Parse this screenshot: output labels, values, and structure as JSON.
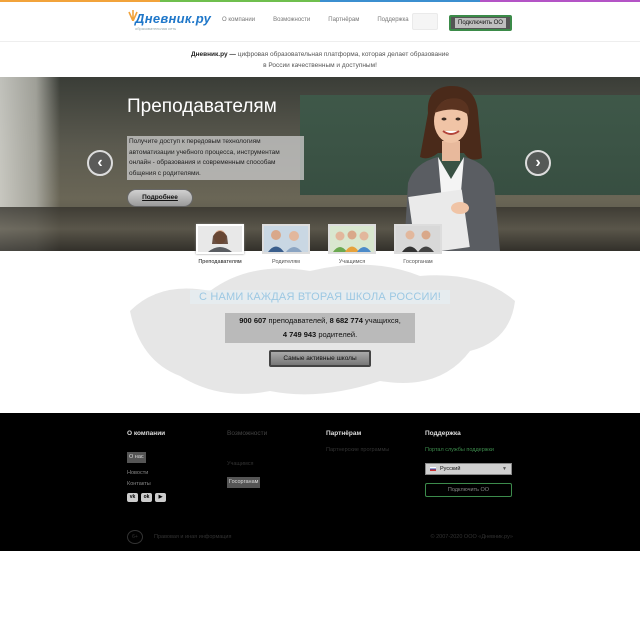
{
  "colors": {
    "top_stripe": [
      "#f2a33b",
      "#6fbf4e",
      "#3b8fd0",
      "#b454c6"
    ],
    "brand_blue": "#1f77c9",
    "accent_green": "#3c8b4c"
  },
  "header": {
    "logo_name": "Дневник.ру",
    "logo_tagline": "образовательная сеть",
    "nav": [
      "О компании",
      "Возможности",
      "Партнёрам",
      "Поддержка"
    ],
    "connect_label": "Подключить ОО"
  },
  "intro": {
    "brand": "Дневник.ру —",
    "line1": "цифровая образовательная платформа, которая делает образование",
    "line2": "в России качественным и доступным!"
  },
  "hero": {
    "title": "Преподавателям",
    "text": "Получите доступ к передовым технологиям автоматизации учебного процесса, инструментам онлайн - образования и современным способам общения с родителями.",
    "more_label": "Подробнее",
    "prev_icon": "chevron-left-icon",
    "next_icon": "chevron-right-icon"
  },
  "audiences": [
    {
      "label": "Преподавателям",
      "active": true
    },
    {
      "label": "Родителям",
      "active": false
    },
    {
      "label": "Учащимся",
      "active": false
    },
    {
      "label": "Госорганам",
      "active": false
    }
  ],
  "stats": {
    "claim": "С НАМИ КАЖДАЯ ВТОРАЯ ШКОЛА РОССИИ!",
    "teachers_count": "900 607",
    "teachers_label": "преподавателей,",
    "students_count": "8 682 774",
    "students_label": "учащихся,",
    "parents_count": "4 749 943",
    "parents_label": "родителей.",
    "button_label": "Самые активные школы"
  },
  "footer": {
    "col1": {
      "heading": "О компании",
      "items": [
        "О нас",
        "Новости",
        "Контакты"
      ],
      "social": [
        "vk-icon",
        "ok-icon",
        "youtube-icon"
      ]
    },
    "col2": {
      "heading": "Возможности",
      "items": [
        "Учащимся",
        "Госорганам"
      ]
    },
    "col3": {
      "heading": "Партнёрам",
      "items": [
        "Партнерские программы"
      ]
    },
    "col4": {
      "heading": "Поддержка",
      "items": [
        "Портал службы поддержки"
      ],
      "language": "Русский",
      "connect_label": "Подключить ОО"
    },
    "bottom_left": "Правовая и иная информация",
    "bottom_right": "© 2007-2020 ООО «Дневник.ру»"
  }
}
